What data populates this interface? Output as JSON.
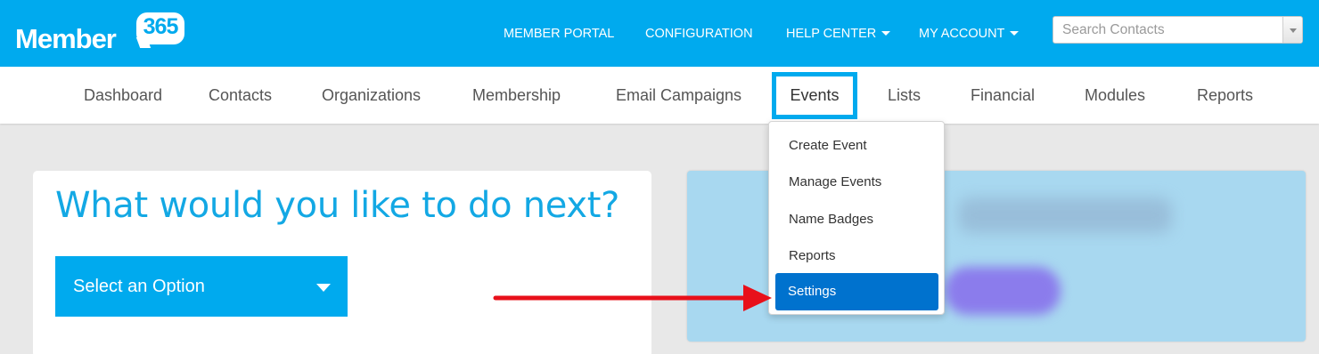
{
  "brand": {
    "logo_text": "Member",
    "logo_number": "365"
  },
  "topnav": {
    "member_portal": "MEMBER PORTAL",
    "configuration": "CONFIGURATION",
    "help_center": "HELP CENTER",
    "my_account": "MY ACCOUNT"
  },
  "search": {
    "placeholder": "Search Contacts"
  },
  "subnav": {
    "dashboard": "Dashboard",
    "contacts": "Contacts",
    "organizations": "Organizations",
    "membership": "Membership",
    "email_campaigns": "Email Campaigns",
    "events": "Events",
    "lists": "Lists",
    "financial": "Financial",
    "modules": "Modules",
    "reports": "Reports"
  },
  "events_menu": {
    "items": [
      "Create Event",
      "Manage Events",
      "Name Badges",
      "Reports",
      "Settings"
    ],
    "active_index": 4
  },
  "main": {
    "prompt_title": "What would you like to do next?",
    "select_label": "Select an Option"
  },
  "colors": {
    "brand_blue": "#00aaee",
    "active_item": "#0072ce",
    "arrow": "#e8101a"
  }
}
